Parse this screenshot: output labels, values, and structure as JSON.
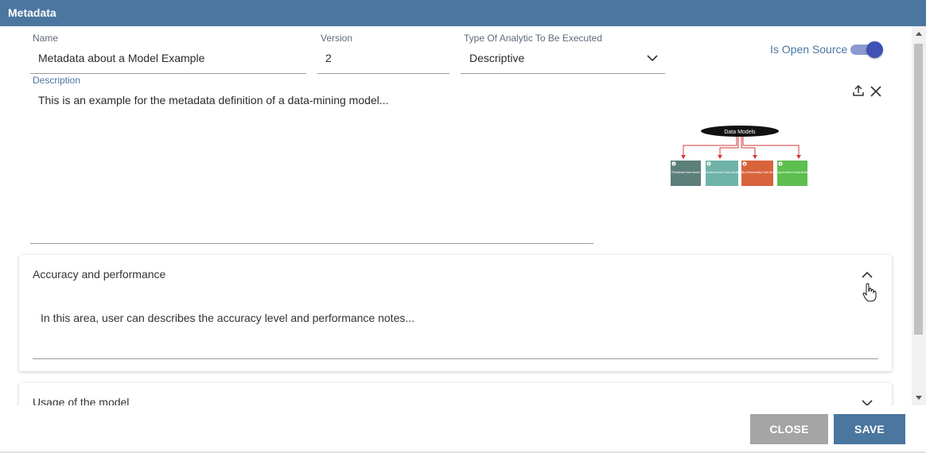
{
  "dialog": {
    "title": "Metadata"
  },
  "fields": {
    "name": {
      "label": "Name",
      "value": "Metadata about a Model Example"
    },
    "version": {
      "label": "Version",
      "value": "2"
    },
    "analytic_type": {
      "label": "Type Of Analytic To Be Executed",
      "value": "Descriptive"
    },
    "open_source": {
      "label": "Is Open Source",
      "checked": true
    },
    "description": {
      "label": "Description",
      "value": "This is an example for the metadata definition of a data-mining model..."
    }
  },
  "image": {
    "title": "Data Models",
    "boxes": [
      {
        "num": "1",
        "text": "Relational Data Model",
        "color": "#5c7f7a"
      },
      {
        "num": "2",
        "text": "Semistructured Data Model",
        "color": "#6fb3a8"
      },
      {
        "num": "3",
        "text": "Entity-Relationship Data Model",
        "color": "#d8643c"
      },
      {
        "num": "4",
        "text": "Object-based Data Model",
        "color": "#5cbf4f"
      }
    ],
    "upload_icon": "upload-icon",
    "remove_icon": "close-icon"
  },
  "sections": [
    {
      "title": "Accuracy and performance",
      "expanded": true,
      "body": "In this area, user can describes the accuracy level and performance notes..."
    },
    {
      "title": "Usage of the model",
      "expanded": false
    }
  ],
  "buttons": {
    "close": "CLOSE",
    "save": "SAVE"
  }
}
